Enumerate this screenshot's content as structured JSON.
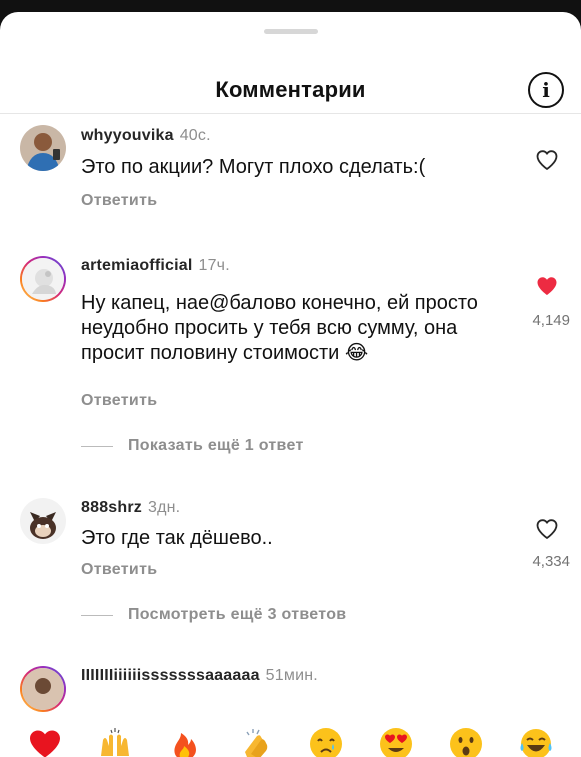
{
  "header": {
    "title": "Комментарии",
    "info_icon": "i"
  },
  "comments": [
    {
      "username": "whyyouvika",
      "time": "40с.",
      "text": "Это по акции? Могут плохо сделать:(",
      "reply_label": "Ответить",
      "liked": false,
      "likes": ""
    },
    {
      "username": "artemiaofficial",
      "time": "17ч.",
      "text": "Ну капец, нае@балово конечно,  ей просто неудобно просить у тебя всю сумму,  она просит половину стоимости 😂",
      "reply_label": "Ответить",
      "liked": true,
      "likes": "4,149",
      "more_label": "Показать ещё 1 ответ"
    },
    {
      "username": "888shrz",
      "time": "3дн.",
      "text": "Это где так дёшево..",
      "reply_label": "Ответить",
      "liked": false,
      "likes": "4,334",
      "more_label": "Посмотреть ещё 3 ответов"
    },
    {
      "username": "IIIIIIIiiiiiisssssssaaaaaa",
      "time": "51мин."
    }
  ],
  "emoji_bar": [
    "red-heart",
    "raising-hands",
    "fire",
    "clapping-hands",
    "crying-face",
    "heart-eyes",
    "astonished-face",
    "tears-of-joy"
  ],
  "colors": {
    "like_red": "#ed2b42",
    "muted": "#8e8e8e"
  }
}
